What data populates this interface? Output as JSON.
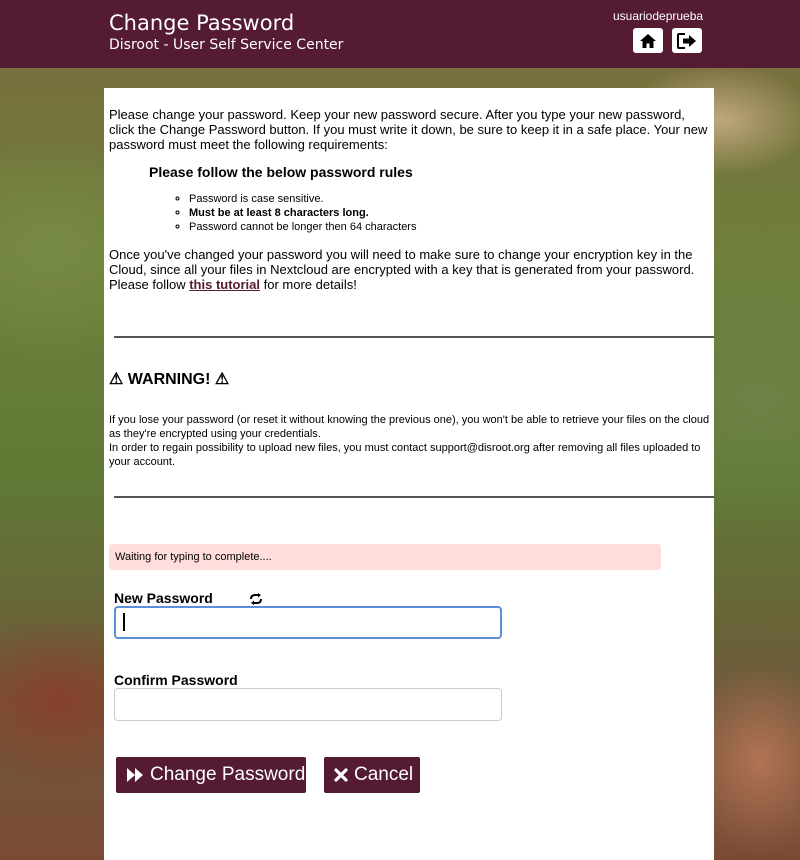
{
  "header": {
    "title": "Change Password",
    "subtitle": "Disroot - User Self Service Center",
    "username": "usuariodeprueba",
    "home_icon": "home-icon",
    "logout_icon": "sign-out-icon"
  },
  "content": {
    "intro": "Please change your password. Keep your new password secure. After you type your new password, click the Change Password button. If you must write it down, be sure to keep it in a safe place. Your new password must meet the following requirements:",
    "rules_title": "Please follow the below password rules",
    "rules": [
      "Password is case sensitive.",
      "Must be at least 8 characters long.",
      "Password cannot be longer then 64 characters"
    ],
    "nextcloud_pre": "Once you've changed your password you will need to make sure to change your encryption key in the Cloud, since all your files in Nextcloud are encrypted with a key that is generated from your password. Please follow ",
    "tutorial_link": "this tutorial",
    "nextcloud_post": " for more details!",
    "warning_title": "⚠ WARNING! ⚠",
    "warning_line1": "If you lose your password (or reset it without knowing the previous one), you won't be able to retrieve your files on the cloud as they're encrypted using your credentials.",
    "warning_line2": "In order to regain possibility to upload new files, you must contact support@disroot.org after removing all files uploaded to your account."
  },
  "form": {
    "status": "Waiting for typing to complete....",
    "new_password_label": "New Password",
    "new_password_value": "",
    "confirm_password_label": "Confirm Password",
    "confirm_password_value": "",
    "submit_label": "Change Password",
    "cancel_label": "Cancel"
  },
  "colors": {
    "brand": "#541b33",
    "status_bg": "#ffdddd",
    "focus": "#5b8fd6"
  }
}
